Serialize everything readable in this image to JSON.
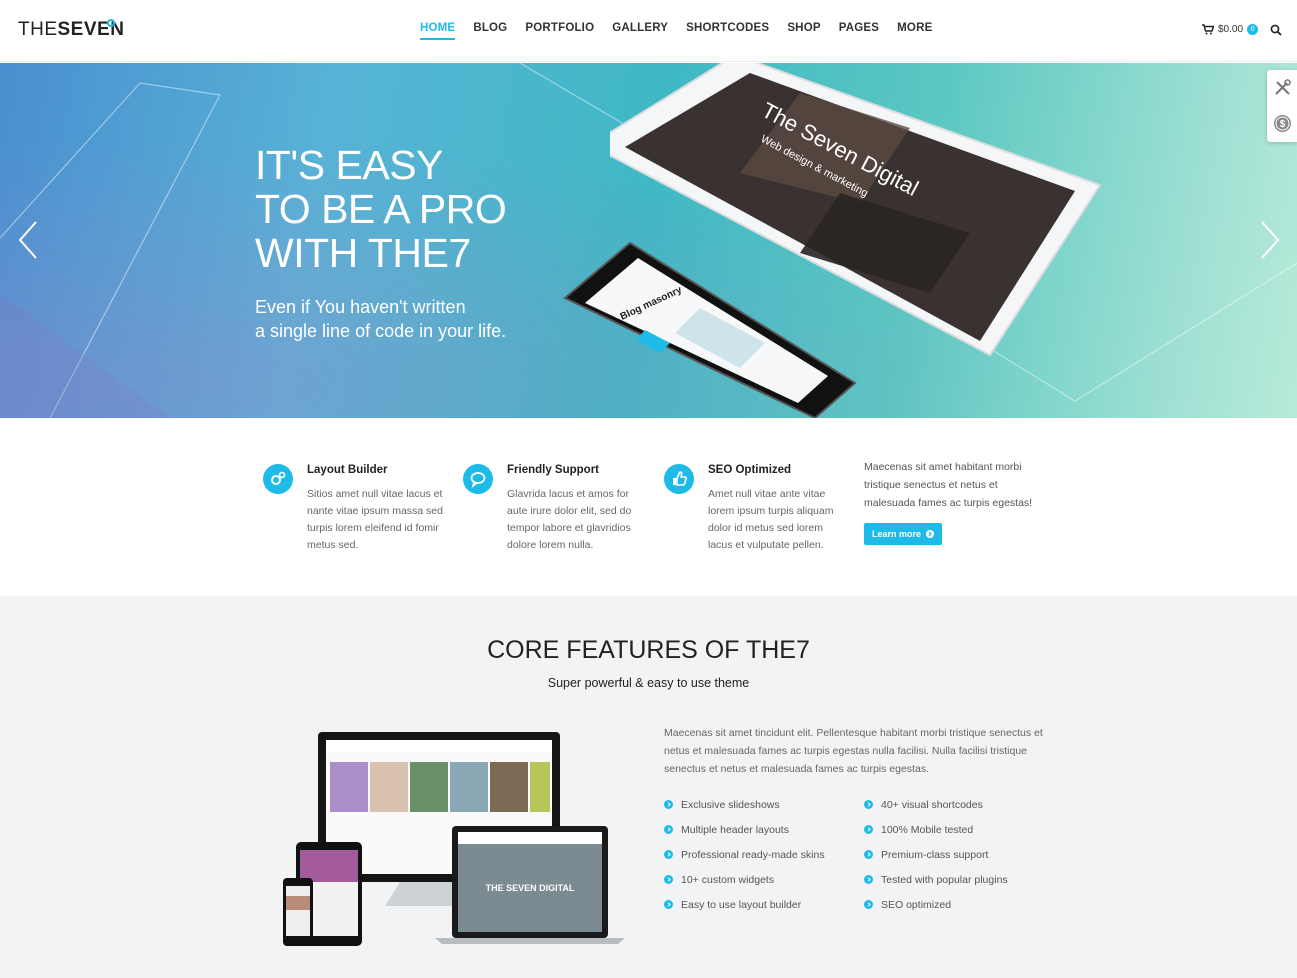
{
  "header": {
    "logo_thin": "THE",
    "logo_bold": "SEVEN",
    "nav": [
      "HOME",
      "BLOG",
      "PORTFOLIO",
      "GALLERY",
      "SHORTCODES",
      "SHOP",
      "PAGES",
      "MORE"
    ],
    "cart_total": "$0.00",
    "cart_count": "0"
  },
  "hero": {
    "title_lines": [
      "IT'S EASY",
      "TO BE A PRO",
      "WITH THE7"
    ],
    "subtitle_lines": [
      "Even if You haven't written",
      "a single line of code in your life."
    ],
    "tablet_title": "The Seven Digital",
    "tablet_sub": "Web design & marketing",
    "phone_title": "Blog masonry"
  },
  "features": [
    {
      "title": "Layout Builder",
      "text": "Sitios amet null vitae lacus et nante vitae ipsum massa sed turpis lorem eleifend id fomir metus sed.",
      "icon": "gears-icon"
    },
    {
      "title": "Friendly Support",
      "text": "Glavrida lacus et amos for aute irure dolor elit, sed do tempor labore et glavridios dolore lorem nulla.",
      "icon": "chat-icon"
    },
    {
      "title": "SEO Optimized",
      "text": "Amet null vitae ante vitae lorem ipsum turpis aliquam dolor id metus sed lorem lacus et vulputate pellen.",
      "icon": "thumbs-up-icon"
    }
  ],
  "promo": {
    "text": "Maecenas sit amet habitant morbi tristique senectus et netus et malesuada fames ac turpis egestas!",
    "button": "Learn more"
  },
  "core": {
    "title": "CORE FEATURES OF THE7",
    "subtitle": "Super powerful & easy to use theme",
    "description": "Maecenas sit amet tincidunt elit. Pellentesque habitant morbi tristique senectus et netus et malesuada fames ac turpis egestas nulla facilisi. Nulla facilisi tristique senectus et netus et malesuada fames ac turpis egestas.",
    "list_left": [
      "Exclusive slideshows",
      "Multiple header layouts",
      "Professional ready-made skins",
      "10+ custom widgets",
      "Easy to use layout builder"
    ],
    "list_right": [
      "40+ visual shortcodes",
      "100% Mobile tested",
      "Premium-class support",
      "Tested with popular plugins",
      "SEO optimized"
    ],
    "laptop_label": "THE SEVEN DIGITAL"
  },
  "colors": {
    "accent": "#1ebbe8"
  }
}
